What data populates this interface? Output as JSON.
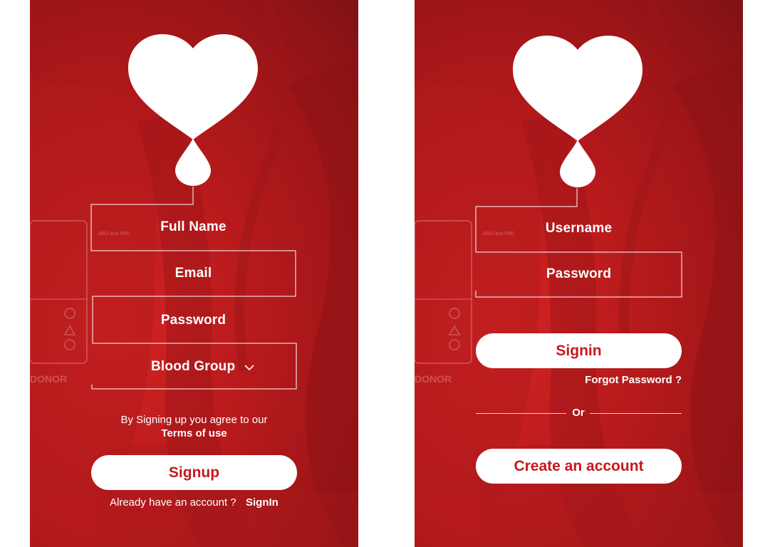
{
  "signup": {
    "fields": {
      "full_name": "Full Name",
      "email": "Email",
      "password": "Password",
      "blood_group": "Blood Group"
    },
    "agree_text": "By Signing up you agree to our",
    "terms_link": "Terms of use",
    "signup_button": "Signup",
    "have_account_text": "Already have an account ?",
    "signin_link": "SignIn"
  },
  "signin": {
    "fields": {
      "username": "Username",
      "password": "Password"
    },
    "signin_button": "Signin",
    "forgot_link": "Forgot Password ?",
    "or_text": "Or",
    "create_account_button": "Create an account"
  },
  "background_label": {
    "donor": "DONOR",
    "abo": "ABO and RhD"
  },
  "colors": {
    "brand_red": "#c9171d",
    "background_dark": "#8f1416",
    "white": "#ffffff"
  },
  "icons": {
    "logo": "heart-blood-drop-icon",
    "dropdown": "chevron-down-icon"
  }
}
